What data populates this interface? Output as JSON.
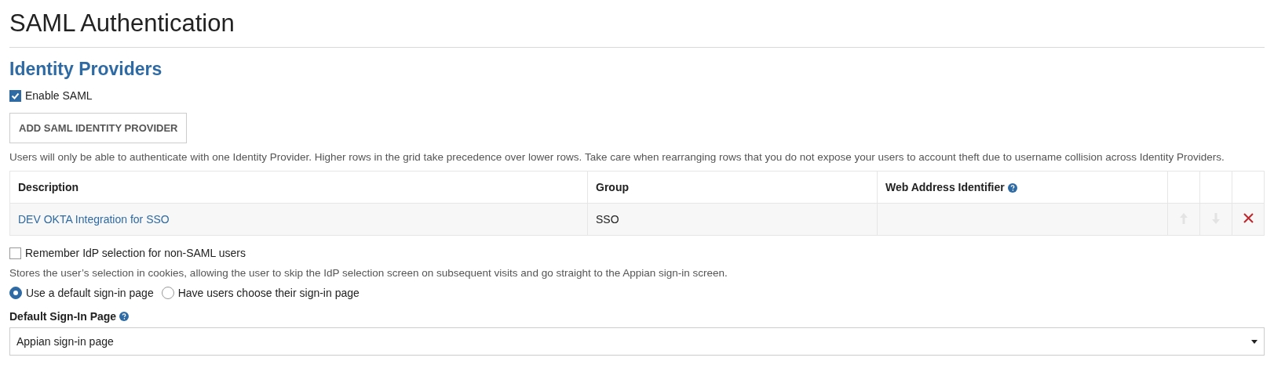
{
  "page_title": "SAML Authentication",
  "section_title": "Identity Providers",
  "enable_saml": {
    "label": "Enable SAML",
    "checked": true
  },
  "add_button": "ADD SAML IDENTITY PROVIDER",
  "instructions": "Users will only be able to authenticate with one Identity Provider. Higher rows in the grid take precedence over lower rows. Take care when rearranging rows that you do not expose your users to account theft due to username collision across Identity Providers.",
  "table": {
    "columns": [
      {
        "label": "Description",
        "help": false
      },
      {
        "label": "Group",
        "help": false
      },
      {
        "label": "Web Address Identifier",
        "help": true
      }
    ],
    "rows": [
      {
        "description": "DEV OKTA Integration for SSO",
        "group": "SSO",
        "move_up_disabled": true,
        "move_down_disabled": true
      }
    ]
  },
  "remember_idp": {
    "label": "Remember IdP selection for non-SAML users",
    "checked": false
  },
  "remember_note": "Stores the user’s selection in cookies, allowing the user to skip the IdP selection screen on subsequent visits and go straight to the Appian sign-in screen.",
  "sign_in_mode": [
    {
      "label": "Use a default sign-in page",
      "selected": true
    },
    {
      "label": "Have users choose their sign-in page",
      "selected": false
    }
  ],
  "default_page": {
    "label": "Default Sign-In Page",
    "help": true,
    "value": "Appian sign-in page"
  }
}
